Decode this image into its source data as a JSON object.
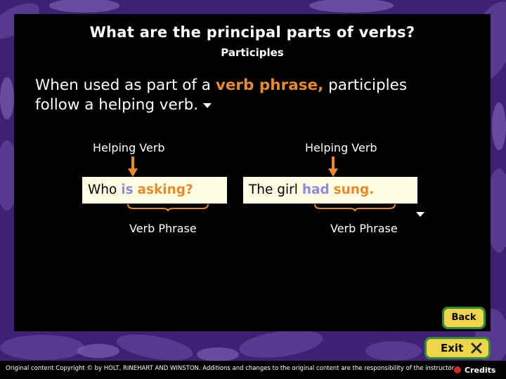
{
  "slide": {
    "title": "What are the principal parts of verbs?",
    "subtitle": "Participles",
    "body_part1": "When used as part of a",
    "body_emph": "verb phrase,",
    "body_part2": "participles",
    "body_line2": "follow a helping verb."
  },
  "examples": [
    {
      "top_label": "Helping Verb",
      "word_plain": "Who",
      "word_helping": "is",
      "word_participle": "asking?",
      "bottom_label": "Verb Phrase"
    },
    {
      "top_label": "Helping Verb",
      "word_plain": "The girl",
      "word_helping": "had",
      "word_participle": "sung.",
      "bottom_label": "Verb Phrase"
    }
  ],
  "buttons": {
    "back_label": "Back",
    "exit_label": "Exit",
    "credits_label": "Credits"
  },
  "footer": {
    "copyright": "Original content Copyright © by HOLT, RINEHART AND WINSTON. Additions and changes to the original content are the responsibility of the instructor."
  },
  "colors": {
    "accent_orange": "#e88a2a",
    "helping_blue": "#8c8cd6",
    "box_fill": "#fffde1",
    "button_green": "#2e8b3a",
    "button_yellow": "#f0d44a"
  }
}
